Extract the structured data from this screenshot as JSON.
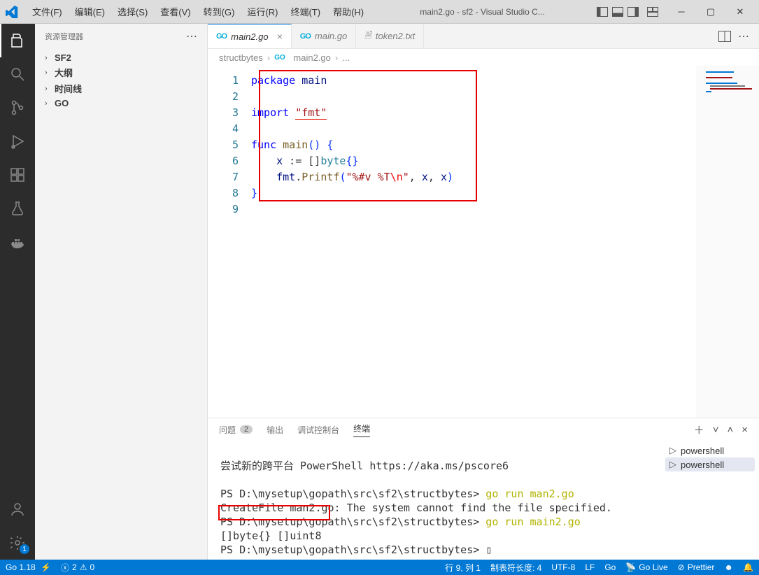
{
  "menu": {
    "file": "文件(F)",
    "edit": "编辑(E)",
    "select": "选择(S)",
    "view": "查看(V)",
    "goto": "转到(G)",
    "run": "运行(R)",
    "terminal": "终端(T)",
    "help": "帮助(H)"
  },
  "title": "main2.go - sf2 - Visual Studio C...",
  "sidebar": {
    "header": "资源管理器",
    "items": [
      "SF2",
      "大纲",
      "时间线",
      "GO"
    ]
  },
  "tabs": [
    {
      "icon": "go",
      "label": "main2.go",
      "active": true,
      "close": true
    },
    {
      "icon": "go",
      "label": "main.go",
      "active": false,
      "close": false
    },
    {
      "icon": "txt",
      "label": "token2.txt",
      "active": false,
      "close": false
    }
  ],
  "breadcrumb": {
    "p0": "structbytes",
    "p1": "main2.go",
    "p2": "..."
  },
  "code": {
    "lines": 9,
    "l1": {
      "kw": "package",
      "sp": " ",
      "id": "main"
    },
    "l3": {
      "kw": "import",
      "sp": " ",
      "str": "\"fmt\""
    },
    "l5": {
      "kw": "func",
      "sp": " ",
      "fn": "main",
      "paren": "() ",
      "brace": "{"
    },
    "l6": {
      "indent": "    ",
      "id": "x",
      "op": " := []",
      "ty": "byte",
      "br": "{}"
    },
    "l7": {
      "indent": "    ",
      "pkg": "fmt",
      "dot": ".",
      "fn": "Printf",
      "open": "(",
      "str1": "\"%#v %T",
      "esc": "\\n",
      "str2": "\"",
      "c1": ", ",
      "x1": "x",
      "c2": ", ",
      "x2": "x",
      "close": ")"
    },
    "l8": "}"
  },
  "panel": {
    "tabs": {
      "problems": "问题",
      "problems_count": "2",
      "output": "输出",
      "debug": "调试控制台",
      "terminal": "终端"
    },
    "termList": [
      "powershell",
      "powershell"
    ],
    "lines": {
      "l1": "尝试新的跨平台 PowerShell https://aka.ms/pscore6",
      "l2": "PS D:\\mysetup\\gopath\\src\\sf2\\structbytes> ",
      "c2": "go run man2.go",
      "l3": "CreateFile man2.go: The system cannot find the file specified.",
      "l4": "PS D:\\mysetup\\gopath\\src\\sf2\\structbytes> ",
      "c4": "go run main2.go",
      "l5": "[]byte{} []uint8",
      "l6": "PS D:\\mysetup\\gopath\\src\\sf2\\structbytes> ",
      "cur": "▯"
    }
  },
  "status": {
    "go": "Go 1.18",
    "errs": "2",
    "warns": "0",
    "pos": "行 9, 列 1",
    "tab": "制表符长度: 4",
    "enc": "UTF-8",
    "eol": "LF",
    "lang": "Go",
    "live": "Go Live",
    "pretty": "Prettier"
  },
  "icons": {
    "search": "⌕",
    "close": "×",
    "dots": "⋯",
    "chev": "›",
    "chevd": "˅",
    "plus": "＋",
    "up": "˄",
    "split": "◫"
  }
}
